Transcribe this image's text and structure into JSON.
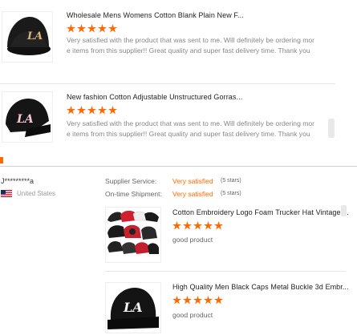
{
  "reviews_top": [
    {
      "title": "Wholesale Mens Womens Cotton Blank Plain New F...",
      "rating": 5,
      "text": "Very satisfied with the product that was sent to me. Will definitely be ordering more items from this supplier!! Great quality and super fast delivery time. Thank you"
    },
    {
      "title": "New fashion Cotton Adjustable Unstructured Gorras...",
      "rating": 5,
      "text": "Very satisfied with the product that was sent to me. Will definitely be ordering more items from this supplier!! Great quality and super fast delivery time. Thank you"
    }
  ],
  "reviewer": {
    "name": "J*********a",
    "country": "United States",
    "supplier_service_label": "Supplier Service:",
    "supplier_service_value": "Very satisfied",
    "supplier_service_stars": "(5 stars)",
    "ontime_label": "On-time Shipment:",
    "ontime_value": "Very satisfied",
    "ontime_stars": "(5 stars)"
  },
  "reviews_bottom": [
    {
      "title": "Cotton Embroidery Logo Foam Trucker Hat Vintage ...",
      "rating": 5,
      "text": "good product"
    },
    {
      "title": "High Quality Men Black Caps Metal Buckle 3d Embr...",
      "rating": 5,
      "text": "good product"
    }
  ],
  "colors": {
    "star": "#ff6a00",
    "accent": "#ff6a00"
  }
}
